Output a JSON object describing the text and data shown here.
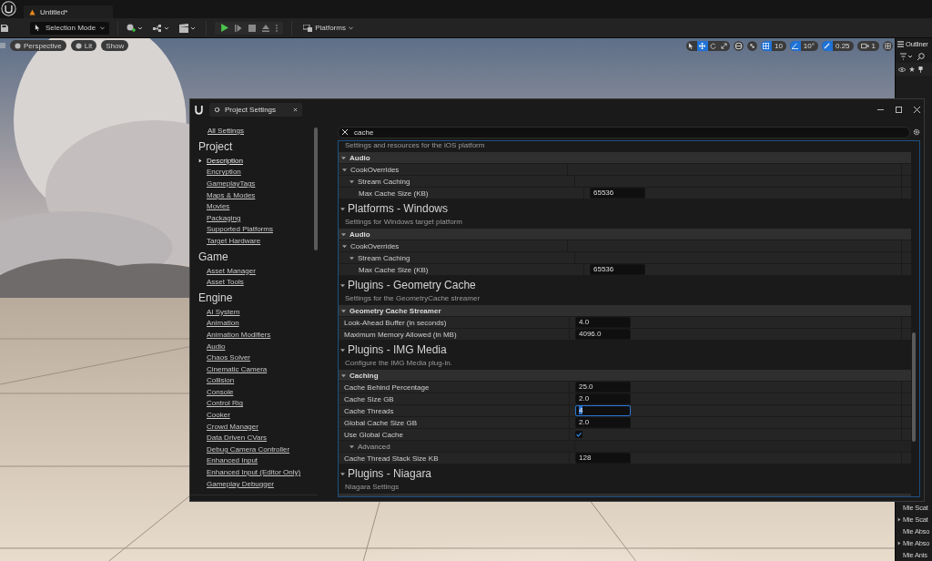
{
  "editor": {
    "tab": {
      "title": "Untitled*"
    },
    "toolbar": {
      "mode": "Selection Mode",
      "platforms": "Platforms"
    },
    "viewport": {
      "chips": [
        "Perspective",
        "Lit",
        "Show"
      ],
      "transform_tools": [
        {
          "kind": "select",
          "selected": false
        },
        {
          "kind": "move",
          "selected": true
        },
        {
          "kind": "rotate",
          "selected": false
        },
        {
          "kind": "scale",
          "selected": false
        }
      ],
      "snaps": [
        {
          "kind": "grid",
          "value": "10",
          "on": true
        },
        {
          "kind": "angle",
          "value": "10°",
          "on": true
        },
        {
          "kind": "scale",
          "value": "0.25",
          "on": true
        }
      ],
      "camera_speed": "1"
    },
    "outliner": {
      "title": "Outliner",
      "items": [
        {
          "label": "Mie Scat",
          "expandable": false
        },
        {
          "label": "Mie Scat",
          "expandable": true
        },
        {
          "label": "Mie Abso",
          "expandable": false
        },
        {
          "label": "Mie Abso",
          "expandable": true
        },
        {
          "label": "Mie Anis",
          "expandable": false
        }
      ]
    }
  },
  "settings_window": {
    "tab": "Project Settings",
    "nav": {
      "all": "All Settings",
      "sections": [
        {
          "title": "Project",
          "items": [
            {
              "label": "Description",
              "selected": true
            },
            {
              "label": "Encryption",
              "selected": false
            },
            {
              "label": "GameplayTags",
              "selected": false
            },
            {
              "label": "Maps & Modes",
              "selected": false
            },
            {
              "label": "Movies",
              "selected": false
            },
            {
              "label": "Packaging",
              "selected": false
            },
            {
              "label": "Supported Platforms",
              "selected": false
            },
            {
              "label": "Target Hardware",
              "selected": false
            }
          ]
        },
        {
          "title": "Game",
          "items": [
            {
              "label": "Asset Manager",
              "selected": false
            },
            {
              "label": "Asset Tools",
              "selected": false
            }
          ]
        },
        {
          "title": "Engine",
          "items": [
            {
              "label": "AI System",
              "selected": false
            },
            {
              "label": "Animation",
              "selected": false
            },
            {
              "label": "Animation Modifiers",
              "selected": false
            },
            {
              "label": "Audio",
              "selected": false
            },
            {
              "label": "Chaos Solver",
              "selected": false
            },
            {
              "label": "Cinematic Camera",
              "selected": false
            },
            {
              "label": "Collision",
              "selected": false
            },
            {
              "label": "Console",
              "selected": false
            },
            {
              "label": "Control Rig",
              "selected": false
            },
            {
              "label": "Cooker",
              "selected": false
            },
            {
              "label": "Crowd Manager",
              "selected": false
            },
            {
              "label": "Data Driven CVars",
              "selected": false
            },
            {
              "label": "Debug Camera Controller",
              "selected": false
            },
            {
              "label": "Enhanced Input",
              "selected": false
            },
            {
              "label": "Enhanced Input (Editor Only)",
              "selected": false
            },
            {
              "label": "Gameplay Debugger",
              "selected": false
            }
          ]
        }
      ]
    },
    "search": {
      "value": "cache"
    },
    "sections": [
      {
        "description": "Settings and resources for the iOS platform",
        "categories": [
          {
            "name": "Audio",
            "expanded": true,
            "rows": [
              {
                "kind": "group",
                "label": "CookOverrides",
                "expanded": true,
                "children": [
                  {
                    "kind": "group",
                    "label": "Stream Caching",
                    "expanded": true,
                    "children": [
                      {
                        "kind": "number",
                        "label": "Max Cache Size (KB)",
                        "value": "65536",
                        "focused": false
                      }
                    ]
                  }
                ]
              }
            ]
          }
        ]
      },
      {
        "title": "Platforms - Windows",
        "expanded": true,
        "description": "Settings for Windows target platform",
        "categories": [
          {
            "name": "Audio",
            "expanded": true,
            "rows": [
              {
                "kind": "group",
                "label": "CookOverrides",
                "expanded": true,
                "children": [
                  {
                    "kind": "group",
                    "label": "Stream Caching",
                    "expanded": true,
                    "children": [
                      {
                        "kind": "number",
                        "label": "Max Cache Size (KB)",
                        "value": "65536",
                        "focused": false
                      }
                    ]
                  }
                ]
              }
            ]
          }
        ]
      },
      {
        "title": "Plugins - Geometry Cache",
        "expanded": true,
        "description": "Settings for the GeometryCache streamer",
        "categories": [
          {
            "name": "Geometry Cache Streamer",
            "expanded": true,
            "rows": [
              {
                "kind": "number",
                "label": "Look-Ahead Buffer (in seconds)",
                "value": "4.0",
                "focused": false
              },
              {
                "kind": "number",
                "label": "Maximum Memory Allowed (in MB)",
                "value": "4096.0",
                "focused": false
              }
            ]
          }
        ]
      },
      {
        "title": "Plugins - IMG Media",
        "expanded": true,
        "description": "Configure the IMG Media plug-in.",
        "categories": [
          {
            "name": "Caching",
            "expanded": true,
            "rows": [
              {
                "kind": "number",
                "label": "Cache Behind Percentage",
                "value": "25.0",
                "focused": false
              },
              {
                "kind": "number",
                "label": "Cache Size GB",
                "value": "2.0",
                "focused": false
              },
              {
                "kind": "number",
                "label": "Cache Threads",
                "value": "4",
                "focused": true
              },
              {
                "kind": "number",
                "label": "Global Cache Size GB",
                "value": "2.0",
                "focused": false
              },
              {
                "kind": "checkbox",
                "label": "Use Global Cache",
                "checked": true
              },
              {
                "kind": "advanced",
                "label": "Advanced",
                "expanded": true
              },
              {
                "kind": "number",
                "label": "Cache Thread Stack Size KB",
                "value": "128",
                "focused": false
              }
            ]
          }
        ]
      },
      {
        "title": "Plugins - Niagara",
        "expanded": true,
        "description": "Niagara Settings"
      }
    ]
  }
}
